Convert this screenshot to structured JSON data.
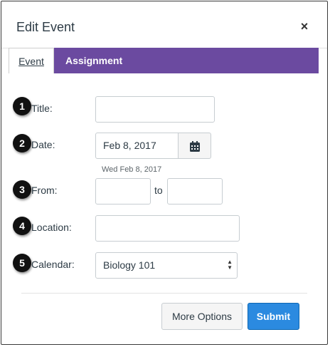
{
  "dialog": {
    "title": "Edit Event",
    "close_glyph": "×",
    "close_icon": "close-icon"
  },
  "tabs": [
    {
      "label": "Event",
      "active": true
    },
    {
      "label": "Assignment",
      "active": false
    }
  ],
  "colors": {
    "tabbar": "#6b4aa0",
    "submit": "#2b8ae0",
    "badge": "#111111"
  },
  "badges": [
    "1",
    "2",
    "3",
    "4",
    "5"
  ],
  "form": {
    "title": {
      "label": "Title:",
      "value": ""
    },
    "date": {
      "label": "Date:",
      "value": "Feb 8, 2017",
      "hint": "Wed Feb 8, 2017",
      "picker_icon": "calendar-icon"
    },
    "time": {
      "label": "From:",
      "from_value": "",
      "separator": "to",
      "to_value": ""
    },
    "location": {
      "label": "Location:",
      "value": ""
    },
    "calendar": {
      "label": "Calendar:",
      "value": "Biology 101",
      "arrows_icon": "select-arrows-icon"
    }
  },
  "buttons": {
    "more_options": "More Options",
    "submit": "Submit"
  }
}
